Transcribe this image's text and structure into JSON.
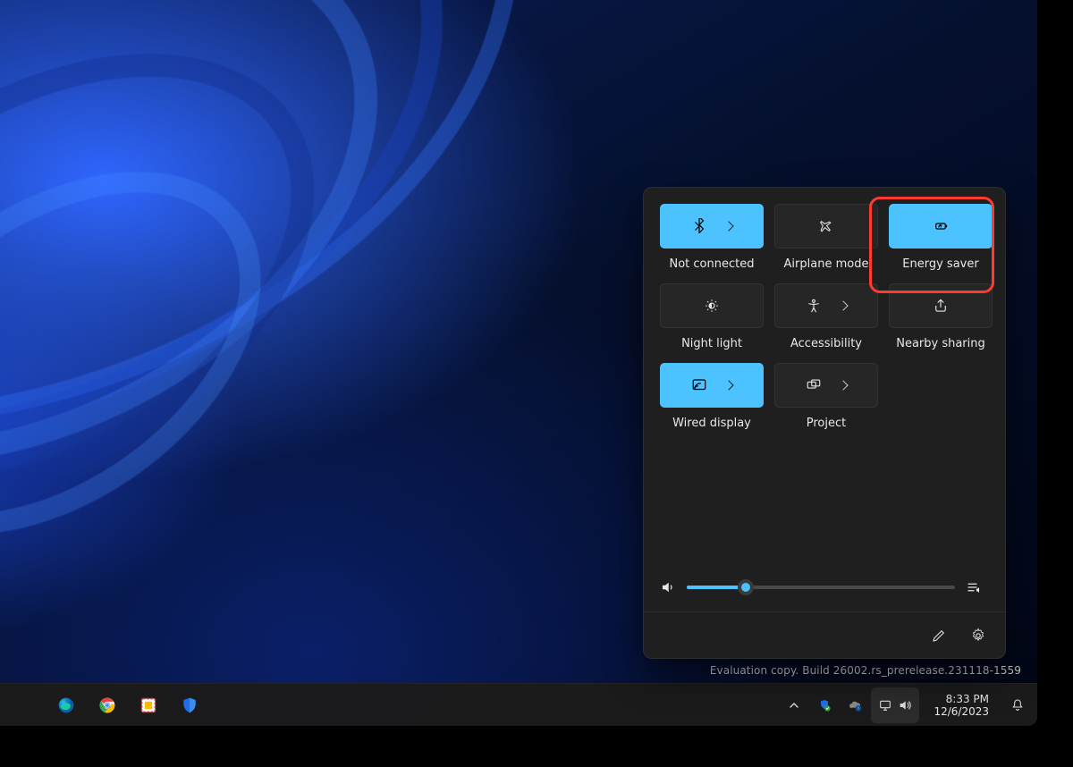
{
  "quick_settings": {
    "tiles": [
      {
        "label": "Not connected",
        "icon": "bluetooth",
        "on": true,
        "expand": true
      },
      {
        "label": "Airplane mode",
        "icon": "airplane",
        "on": false,
        "expand": false
      },
      {
        "label": "Energy saver",
        "icon": "energy",
        "on": true,
        "expand": false
      },
      {
        "label": "Night light",
        "icon": "nightlight",
        "on": false,
        "expand": false
      },
      {
        "label": "Accessibility",
        "icon": "access",
        "on": false,
        "expand": true
      },
      {
        "label": "Nearby sharing",
        "icon": "share",
        "on": false,
        "expand": false
      },
      {
        "label": "Wired display",
        "icon": "cast",
        "on": true,
        "expand": true
      },
      {
        "label": "Project",
        "icon": "project",
        "on": false,
        "expand": true
      }
    ],
    "volume_percent": 22,
    "footer": {
      "edit_label": "Edit quick settings",
      "settings_label": "All settings"
    }
  },
  "watermark": {
    "line2": "Evaluation copy. Build 26002.rs_prerelease.231118-1559"
  },
  "taskbar": {
    "time": "8:33 PM",
    "date": "12/6/2023"
  }
}
